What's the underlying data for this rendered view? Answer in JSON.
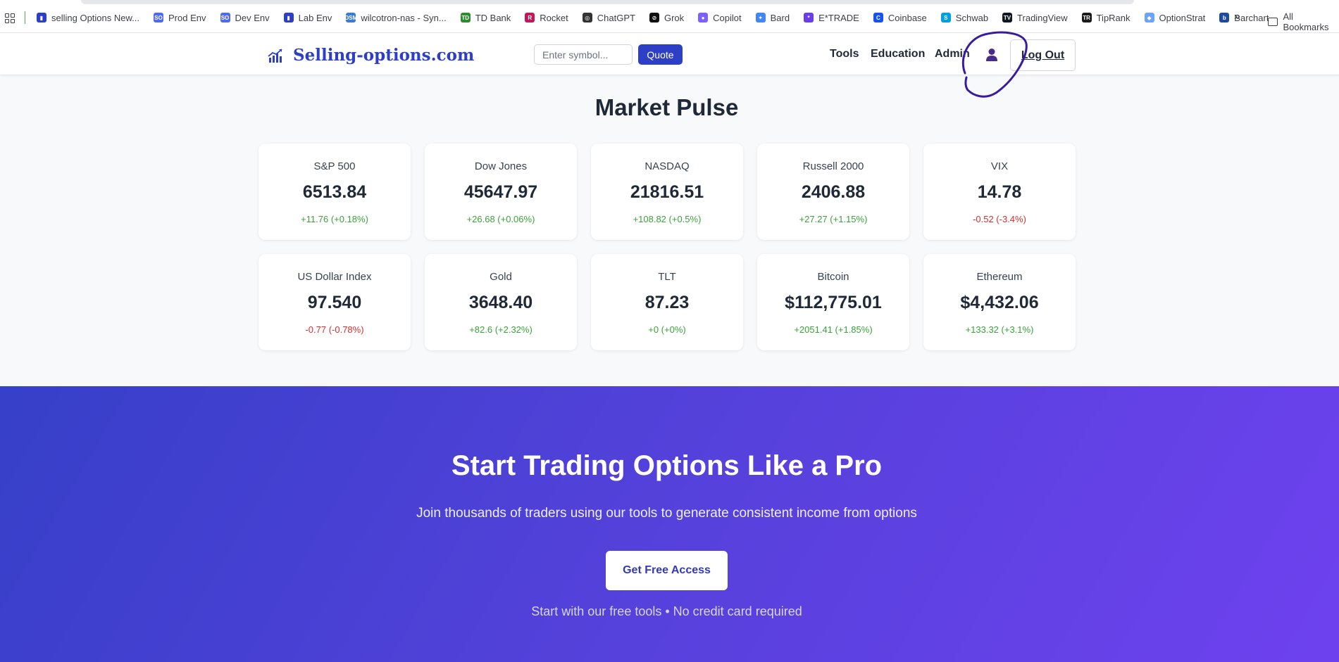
{
  "bookmarks": {
    "items": [
      {
        "label": "selling Options New...",
        "icon": "chart-icon",
        "color": "#2d3fc4"
      },
      {
        "label": "Prod Env",
        "icon": "so-icon",
        "color": "#4f6bed"
      },
      {
        "label": "Dev Env",
        "icon": "so-icon",
        "color": "#4f6bed"
      },
      {
        "label": "Lab Env",
        "icon": "chart-icon",
        "color": "#2d3fc4"
      },
      {
        "label": "wilcotron-nas - Syn...",
        "icon": "dsm-icon",
        "color": "#3a7bd5"
      },
      {
        "label": "TD Bank",
        "icon": "td-icon",
        "color": "#2e8b2e"
      },
      {
        "label": "Rocket",
        "icon": "rocket-icon",
        "color": "#c2185b"
      },
      {
        "label": "ChatGPT",
        "icon": "openai-icon",
        "color": "#333333"
      },
      {
        "label": "Grok",
        "icon": "grok-icon",
        "color": "#111111"
      },
      {
        "label": "Copilot",
        "icon": "copilot-icon",
        "color": "#7b61ff"
      },
      {
        "label": "Bard",
        "icon": "sparkle-icon",
        "color": "#4285f4"
      },
      {
        "label": "E*TRADE",
        "icon": "etrade-icon",
        "color": "#6a3de8"
      },
      {
        "label": "Coinbase",
        "icon": "coinbase-icon",
        "color": "#1652f0"
      },
      {
        "label": "Schwab",
        "icon": "schwab-icon",
        "color": "#00a0df"
      },
      {
        "label": "TradingView",
        "icon": "tradingview-icon",
        "color": "#131722"
      },
      {
        "label": "TipRank",
        "icon": "tipranks-icon",
        "color": "#1a1a1a"
      },
      {
        "label": "OptionStrat",
        "icon": "optionstrat-icon",
        "color": "#6ba4ff"
      },
      {
        "label": "Barchart",
        "icon": "barchart-icon",
        "color": "#1e4b9b"
      }
    ],
    "more": "»",
    "all_bookmarks": "All Bookmarks"
  },
  "nav": {
    "logo_text": "Selling-options.com",
    "search_placeholder": "Enter symbol...",
    "quote_label": "Quote",
    "links": [
      "Tools",
      "Education",
      "Admin"
    ],
    "logout_label": "Log Out"
  },
  "market_pulse": {
    "title": "Market Pulse",
    "cards": [
      {
        "name": "S&P 500",
        "price": "6513.84",
        "change": "+11.76 (+0.18%)",
        "direction": "up"
      },
      {
        "name": "Dow Jones",
        "price": "45647.97",
        "change": "+26.68 (+0.06%)",
        "direction": "up"
      },
      {
        "name": "NASDAQ",
        "price": "21816.51",
        "change": "+108.82 (+0.5%)",
        "direction": "up"
      },
      {
        "name": "Russell 2000",
        "price": "2406.88",
        "change": "+27.27 (+1.15%)",
        "direction": "up"
      },
      {
        "name": "VIX",
        "price": "14.78",
        "change": "-0.52 (-3.4%)",
        "direction": "down"
      },
      {
        "name": "US Dollar Index",
        "price": "97.540",
        "change": "-0.77 (-0.78%)",
        "direction": "down"
      },
      {
        "name": "Gold",
        "price": "3648.40",
        "change": "+82.6 (+2.32%)",
        "direction": "up"
      },
      {
        "name": "TLT",
        "price": "87.23",
        "change": "+0 (+0%)",
        "direction": "up"
      },
      {
        "name": "Bitcoin",
        "price": "$112,775.01",
        "change": "+2051.41 (+1.85%)",
        "direction": "up"
      },
      {
        "name": "Ethereum",
        "price": "$4,432.06",
        "change": "+133.32 (+3.1%)",
        "direction": "up"
      }
    ]
  },
  "hero": {
    "title": "Start Trading Options Like a Pro",
    "subtitle": "Join thousands of traders using our tools to generate consistent income from options",
    "cta_label": "Get Free Access",
    "note": "Start with our free tools • No credit card required"
  },
  "colors": {
    "brand": "#2d3fc4",
    "up": "#3aa23a",
    "down": "#d32f2f",
    "hero_start": "#3640c8",
    "hero_end": "#6e41ef",
    "annotation": "#3a1a9e"
  }
}
